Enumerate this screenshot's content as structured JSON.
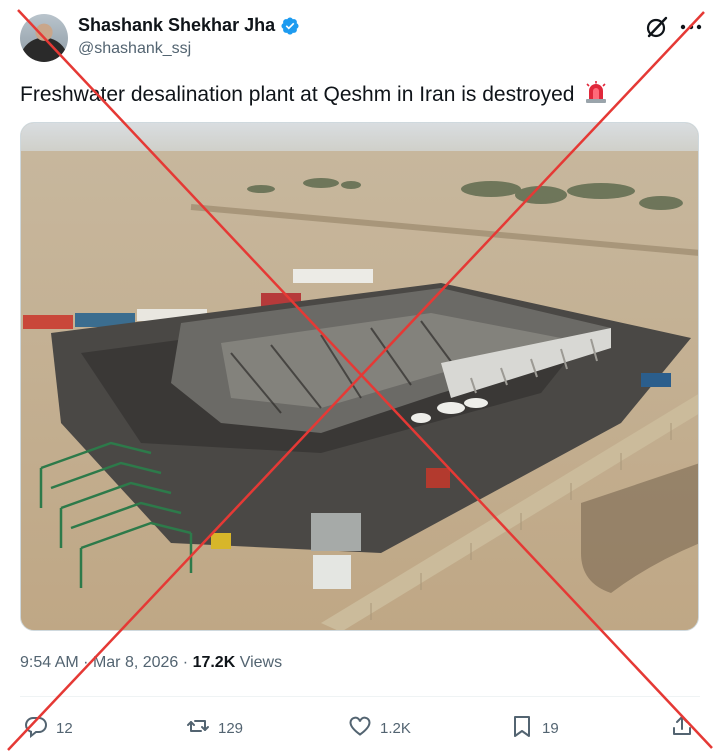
{
  "author": {
    "display_name": "Shashank Shekhar Jha",
    "handle": "@shashank_ssj",
    "verified": true
  },
  "icons": {
    "verified": "verified-badge-icon",
    "grok": "grok-icon",
    "more": "more-options-icon",
    "siren": "police-siren-emoji",
    "reply": "reply-icon",
    "repost": "repost-icon",
    "like": "like-icon",
    "bookmark": "bookmark-icon",
    "share": "share-icon"
  },
  "post": {
    "text": "Freshwater desalination plant at Qeshm in Iran is destroyed"
  },
  "meta": {
    "time": "9:54 AM",
    "date": "Mar 8, 2026",
    "views_count": "17.2K",
    "views_label": "Views"
  },
  "actions": {
    "replies": "12",
    "reposts": "129",
    "likes": "1.2K",
    "bookmarks": "19"
  },
  "colors": {
    "accent": "#1d9bf0",
    "cross": "#e53935",
    "secondary_text": "#536471"
  }
}
